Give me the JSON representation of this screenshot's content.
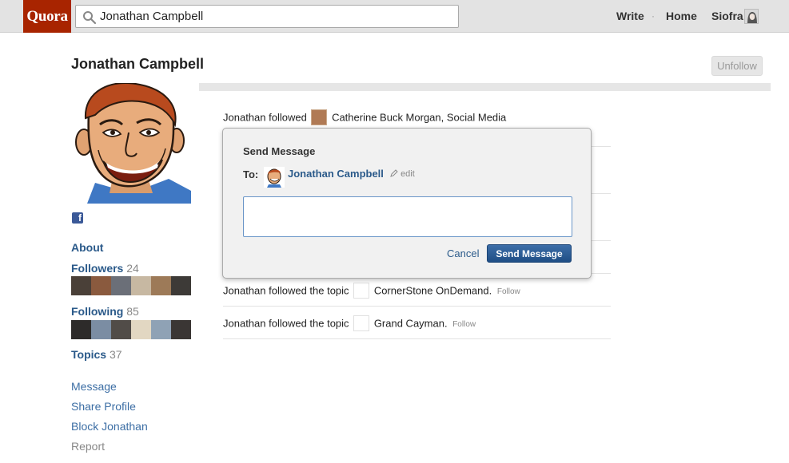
{
  "topbar": {
    "logo": "Quora",
    "search_value": "Jonathan Campbell",
    "nav": {
      "write": "Write",
      "separator": "·",
      "home": "Home",
      "user": "Siofra"
    }
  },
  "profile": {
    "name": "Jonathan Campbell",
    "unfollow_label": "Unfollow",
    "facebook_letter": "f",
    "about_label": "About",
    "followers_label": "Followers",
    "followers_count": "24",
    "following_label": "Following",
    "following_count": "85",
    "topics_label": "Topics",
    "topics_count": "37",
    "actions": {
      "message": "Message",
      "share": "Share Profile",
      "block": "Block Jonathan",
      "report": "Report"
    }
  },
  "feed": [
    {
      "prefix": "Jonathan followed",
      "target": "Catherine Buck Morgan, Social Media",
      "follow": ""
    },
    {
      "prefix": "Jonathan followed the topic",
      "target": "CornerStone OnDemand.",
      "follow": "Follow"
    },
    {
      "prefix": "Jonathan followed the topic",
      "target": "Grand Cayman.",
      "follow": "Follow"
    }
  ],
  "modal": {
    "title": "Send Message",
    "to_label": "To:",
    "recipient": "Jonathan Campbell",
    "edit_label": "edit",
    "message_value": "",
    "cancel_label": "Cancel",
    "send_label": "Send Message"
  },
  "colors": {
    "brand": "#a82400",
    "link": "#2b5a8a",
    "button": "#2a5a95",
    "facebook": "#3b5998"
  }
}
